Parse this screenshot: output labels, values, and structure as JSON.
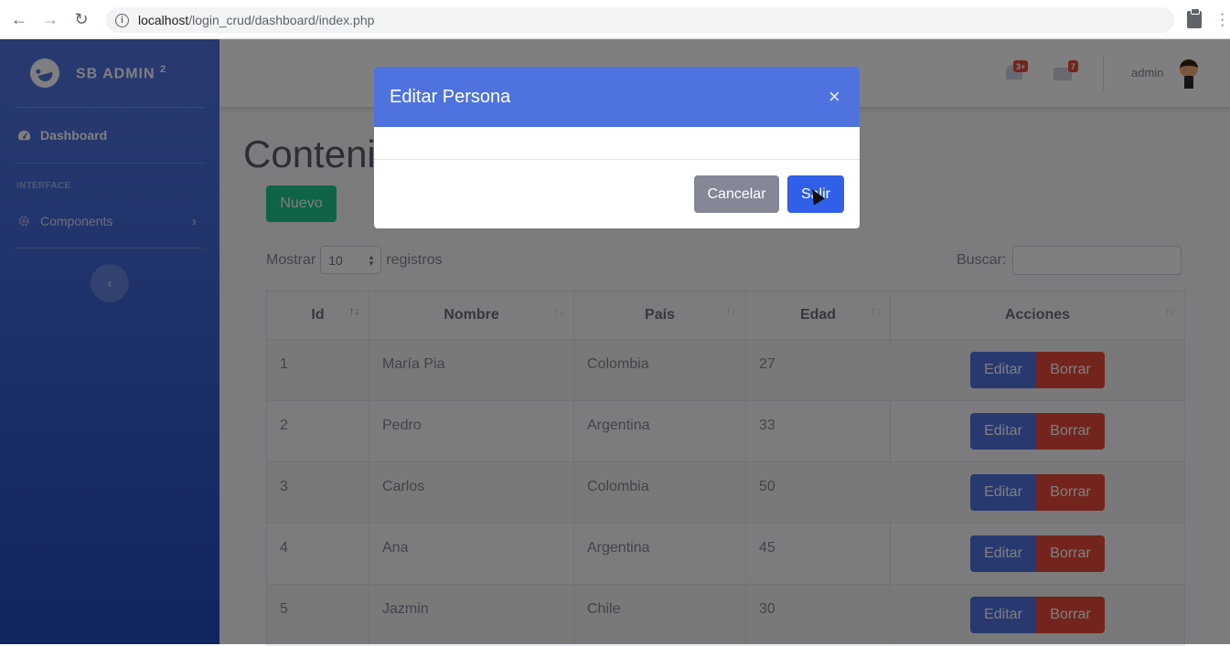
{
  "browser": {
    "url_host": "localhost",
    "url_path": "/login_crud/dashboard/index.php"
  },
  "sidebar": {
    "brand": "SB ADMIN",
    "brand_sup": "2",
    "items": [
      {
        "label": "Dashboard",
        "icon": "tachometer-icon"
      },
      {
        "label": "Components",
        "icon": "cog-icon"
      }
    ],
    "heading": "INTERFACE"
  },
  "topbar": {
    "alerts_badge": "3+",
    "messages_badge": "7",
    "user_name": "admin"
  },
  "page": {
    "title": "Conteni",
    "new_button": "Nuevo",
    "show_label": "Mostrar",
    "page_length": "10",
    "records_label": "registros",
    "search_label": "Buscar:"
  },
  "table": {
    "columns": [
      "Id",
      "Nombre",
      "País",
      "Edad",
      "Acciones"
    ],
    "rows": [
      {
        "id": "1",
        "nombre": "María Pia",
        "pais": "Colombia",
        "edad": "27"
      },
      {
        "id": "2",
        "nombre": "Pedro",
        "pais": "Argentina",
        "edad": "33"
      },
      {
        "id": "3",
        "nombre": "Carlos",
        "pais": "Colombia",
        "edad": "50"
      },
      {
        "id": "4",
        "nombre": "Ana",
        "pais": "Argentina",
        "edad": "45"
      },
      {
        "id": "5",
        "nombre": "Jazmin",
        "pais": "Chile",
        "edad": "30"
      }
    ],
    "edit_label": "Editar",
    "delete_label": "Borrar"
  },
  "modal": {
    "title": "Editar Persona",
    "close": "×",
    "cancel_label": "Cancelar",
    "exit_label": "Salir"
  },
  "colors": {
    "primary": "#4e73df",
    "success": "#1cc88a",
    "danger": "#e74a3b",
    "secondary": "#858796"
  }
}
